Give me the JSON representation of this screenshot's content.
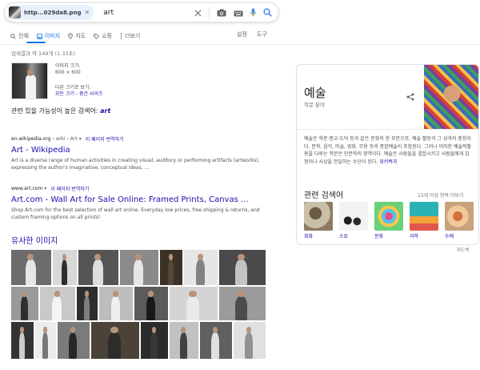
{
  "search": {
    "chip_label": "http...029da8.png",
    "query": "art"
  },
  "tabs": [
    {
      "label": "전체",
      "icon": "search-icon",
      "active": false
    },
    {
      "label": "이미지",
      "icon": "image-icon",
      "active": true
    },
    {
      "label": "지도",
      "icon": "map-pin-icon",
      "active": false
    },
    {
      "label": "쇼핑",
      "icon": "tag-icon",
      "active": false
    },
    {
      "label": "더보기",
      "icon": "more-vert-icon",
      "active": false
    }
  ],
  "tools": {
    "settings": "설정",
    "tools": "도구"
  },
  "stats": "검색결과 약 149개 (1.33초)",
  "query_image": {
    "size_label": "이미지 크기:",
    "size_value": "600 × 600",
    "other_sizes": "다른 크기로 보기:",
    "size_links": "모든 크기 - 중간 사이즈"
  },
  "best_guess": {
    "prefix": "관련 있을 가능성이 높은 검색어:",
    "term": "art"
  },
  "results": [
    {
      "url": "en.wikipedia.org",
      "path": "› wiki › Art",
      "translate": "이 페이지 번역하기",
      "title": "Art - Wikipedia",
      "snippet": "Art is a diverse range of human activities in creating visual, auditory or performing artifacts (artworks), expressing the author's imaginative, conceptual ideas, ..."
    },
    {
      "url": "www.art.com",
      "path": "",
      "translate": "이 페이지 번역하기",
      "title": "Art.com - Wall Art for Sale Online: Framed Prints, Canvas ...",
      "snippet": "Shop Art.com for the best selection of wall art online. Everyday low prices, free shipping & returns, and custom framing options on all prints!"
    }
  ],
  "similar_images_title": "유사한 이미지",
  "knowledge_panel": {
    "title": "예술",
    "subtitle": "학문 분야",
    "description": "예술은 학문·종교·도덕 등과 같은 문화의 한 부문으로, 예술 활동과 그 성과의 총칭이다. 문학, 음악, 미술, 영화, 무용 등의 종합예술이 포함된다. 그러나 이러한 예술적활용을 다루는 학문은 인문학의 영역이다. 예술은 사람들을 결합시키고 사람들에게 감정이나 사상을 전달하는 수단이 된다.",
    "source_link": "위키백과",
    "related_title": "관련 검색어",
    "related_more": "15개 이상 항목 더보기",
    "related": [
      {
        "label": "회화"
      },
      {
        "label": "소묘"
      },
      {
        "label": "문화"
      },
      {
        "label": "과학"
      },
      {
        "label": "수예"
      }
    ]
  },
  "feedback": "피드백",
  "colors": {
    "link": "#1a0dab",
    "accent": "#1a73e8",
    "text": "#202124",
    "muted": "#70757a"
  }
}
